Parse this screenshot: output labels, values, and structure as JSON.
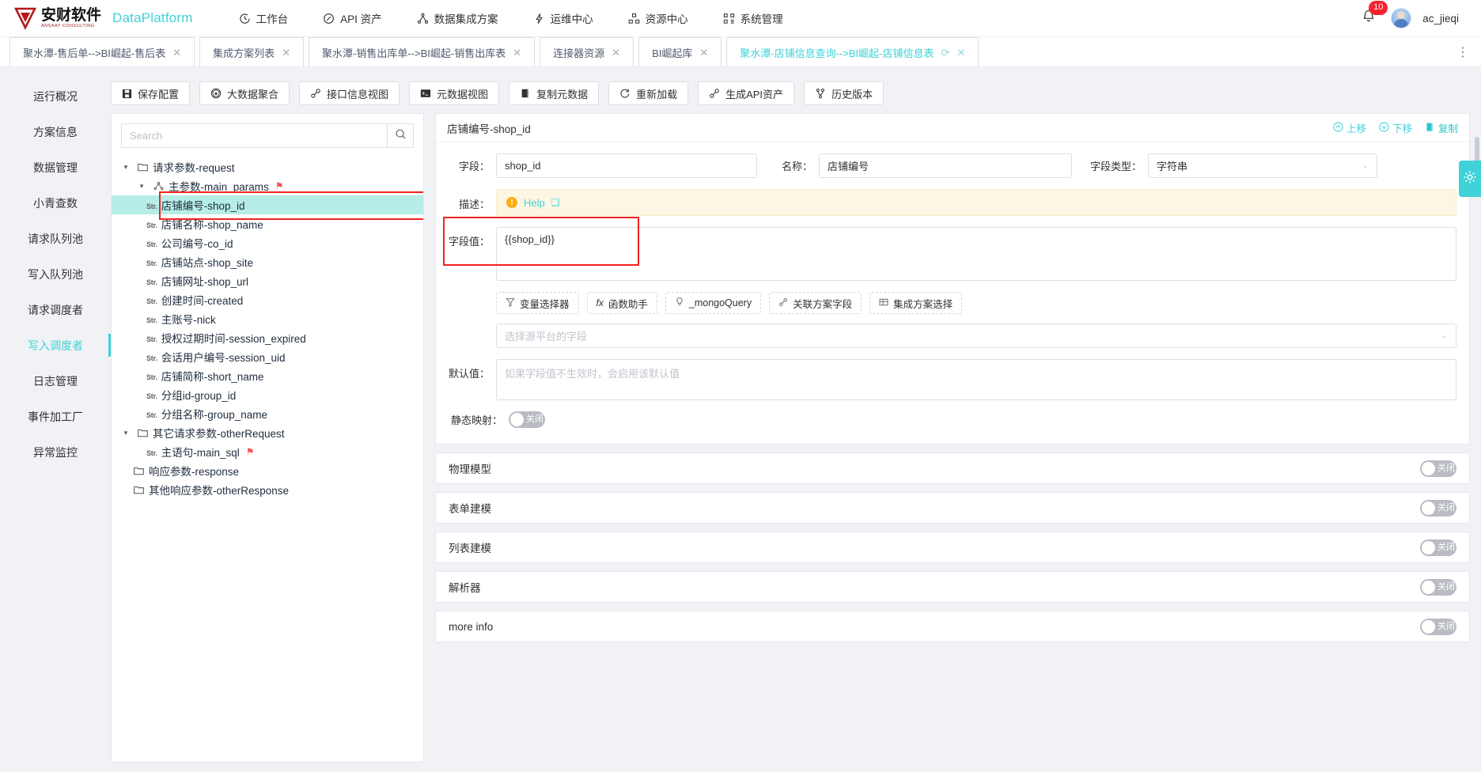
{
  "header": {
    "brand_cn": "安财软件",
    "brand_sub": "ANSAAY CONSULTING",
    "product": "DataPlatform",
    "nav": [
      {
        "label": "工作台",
        "icon": "clock-icon"
      },
      {
        "label": "API 资产",
        "icon": "compass-icon"
      },
      {
        "label": "数据集成方案",
        "icon": "sitemap-icon"
      },
      {
        "label": "运维中心",
        "icon": "lightning-icon"
      },
      {
        "label": "资源中心",
        "icon": "grid-icon"
      },
      {
        "label": "系统管理",
        "icon": "settings-grid-icon"
      }
    ],
    "notification_count": "10",
    "username": "ac_jieqi"
  },
  "tabs": [
    {
      "label": "聚水潭-售后单-->BI崛起-售后表",
      "active": false,
      "refresh": false
    },
    {
      "label": "集成方案列表",
      "active": false,
      "refresh": false
    },
    {
      "label": "聚水潭-销售出库单-->BI崛起-销售出库表",
      "active": false,
      "refresh": false
    },
    {
      "label": "连接器资源",
      "active": false,
      "refresh": false
    },
    {
      "label": "BI崛起库",
      "active": false,
      "refresh": false
    },
    {
      "label": "聚水潭-店铺信息查询-->BI崛起-店铺信息表",
      "active": true,
      "refresh": true
    }
  ],
  "tabbar_more": "⋮",
  "leftnav": [
    {
      "label": "运行概况",
      "active": false
    },
    {
      "label": "方案信息",
      "active": false
    },
    {
      "label": "数据管理",
      "active": false
    },
    {
      "label": "小青查数",
      "active": false
    },
    {
      "label": "请求队列池",
      "active": false
    },
    {
      "label": "写入队列池",
      "active": false
    },
    {
      "label": "请求调度者",
      "active": false
    },
    {
      "label": "写入调度者",
      "active": true
    },
    {
      "label": "日志管理",
      "active": false
    },
    {
      "label": "事件加工厂",
      "active": false
    },
    {
      "label": "异常监控",
      "active": false
    }
  ],
  "toolbar": [
    {
      "label": "保存配置",
      "icon": "save-icon"
    },
    {
      "label": "大数据聚合",
      "icon": "aggregate-icon"
    },
    {
      "label": "接口信息视图",
      "icon": "link-icon"
    },
    {
      "label": "元数据视图",
      "icon": "terminal-icon"
    },
    {
      "label": "复制元数据",
      "icon": "copy-icon"
    },
    {
      "label": "重新加载",
      "icon": "reload-icon"
    },
    {
      "label": "生成API资产",
      "icon": "link-icon"
    },
    {
      "label": "历史版本",
      "icon": "branch-icon"
    }
  ],
  "tree": {
    "search_placeholder": "Search",
    "search_value": "",
    "nodes": [
      {
        "label": "请求参数-request",
        "type": "folder",
        "depth": 0,
        "caret": "▾",
        "flag": false
      },
      {
        "label": "主参数-main_params",
        "type": "params",
        "depth": 1,
        "caret": "▾",
        "flag": true
      },
      {
        "label": "店铺编号-shop_id",
        "type": "str",
        "depth": 2,
        "caret": "",
        "flag": false,
        "selected": true,
        "highlight": true
      },
      {
        "label": "店铺名称-shop_name",
        "type": "str",
        "depth": 2,
        "caret": "",
        "flag": false
      },
      {
        "label": "公司编号-co_id",
        "type": "str",
        "depth": 2,
        "caret": "",
        "flag": false
      },
      {
        "label": "店铺站点-shop_site",
        "type": "str",
        "depth": 2,
        "caret": "",
        "flag": false
      },
      {
        "label": "店铺网址-shop_url",
        "type": "str",
        "depth": 2,
        "caret": "",
        "flag": false
      },
      {
        "label": "创建时间-created",
        "type": "str",
        "depth": 2,
        "caret": "",
        "flag": false
      },
      {
        "label": "主账号-nick",
        "type": "str",
        "depth": 2,
        "caret": "",
        "flag": false
      },
      {
        "label": "授权过期时间-session_expired",
        "type": "str",
        "depth": 2,
        "caret": "",
        "flag": false
      },
      {
        "label": "会话用户编号-session_uid",
        "type": "str",
        "depth": 2,
        "caret": "",
        "flag": false
      },
      {
        "label": "店铺简称-short_name",
        "type": "str",
        "depth": 2,
        "caret": "",
        "flag": false
      },
      {
        "label": "分组id-group_id",
        "type": "str",
        "depth": 2,
        "caret": "",
        "flag": false
      },
      {
        "label": "分组名称-group_name",
        "type": "str",
        "depth": 2,
        "caret": "",
        "flag": false
      },
      {
        "label": "其它请求参数-otherRequest",
        "type": "folder",
        "depth": 1,
        "caret": "▾",
        "flag": false
      },
      {
        "label": "主语句-main_sql",
        "type": "str",
        "depth": 2,
        "caret": "",
        "flag": true
      },
      {
        "label": "响应参数-response",
        "type": "folder",
        "depth": 1,
        "caret": "",
        "flag": false
      },
      {
        "label": "其他响应参数-otherResponse",
        "type": "folder",
        "depth": 1,
        "caret": "",
        "flag": false
      }
    ]
  },
  "detail": {
    "title": "店铺编号-shop_id",
    "actions": [
      {
        "label": "上移",
        "icon": "arrow-up-circle-icon"
      },
      {
        "label": "下移",
        "icon": "arrow-down-circle-icon"
      },
      {
        "label": "复制",
        "icon": "copy-icon"
      }
    ],
    "field_label": "字段：",
    "field_value": "shop_id",
    "name_label": "名称：",
    "name_value": "店铺编号",
    "type_label": "字段类型：",
    "type_value": "字符串",
    "desc_label": "描述：",
    "desc_help": "Help",
    "fieldvalue_label": "字段值：",
    "fieldvalue_value": "{{shop_id}}",
    "chips": [
      {
        "label": "变量选择器",
        "icon": "filter-icon"
      },
      {
        "label": "函数助手",
        "icon": "fx-icon"
      },
      {
        "label": "_mongoQuery",
        "icon": "bulb-icon"
      },
      {
        "label": "关联方案字段",
        "icon": "link-icon"
      },
      {
        "label": "集成方案选择",
        "icon": "table-icon"
      }
    ],
    "source_select_placeholder": "选择源平台的字段",
    "default_label": "默认值：",
    "default_placeholder": "如果字段值不生效时，会启用该默认值",
    "static_map_label": "静态映射：",
    "switch_off_text": "关闭"
  },
  "accordions": [
    {
      "label": "物理模型",
      "state": "关闭"
    },
    {
      "label": "表单建模",
      "state": "关闭"
    },
    {
      "label": "列表建模",
      "state": "关闭"
    },
    {
      "label": "解析器",
      "state": "关闭"
    },
    {
      "label": "more info",
      "state": "关闭"
    }
  ],
  "colors": {
    "accent": "#3fd2d8",
    "selected_row": "#b6ede7",
    "highlight_border": "#f1231e",
    "badge": "#f5222d",
    "nav_bg": "#f0f2f5"
  }
}
